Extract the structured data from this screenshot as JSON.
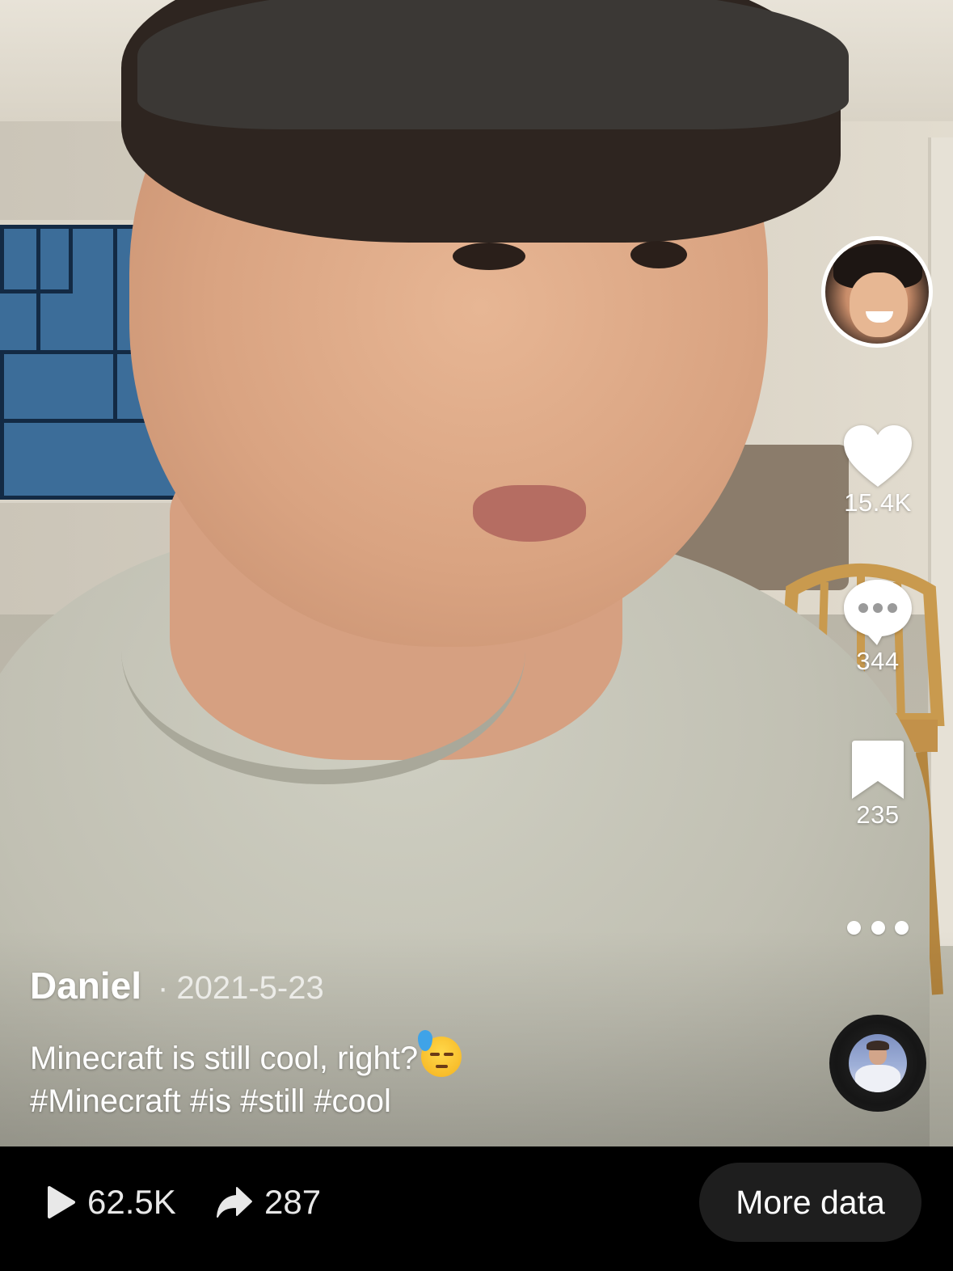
{
  "post": {
    "author": "Daniel",
    "separator": "·",
    "date": "2021-5-23",
    "caption_text": "Minecraft is still cool, right?",
    "caption_emoji": "downcast-face-with-sweat-emoji",
    "hashtags": "#Minecraft #is #still #cool"
  },
  "actions": {
    "likes": "15.4K",
    "comments": "344",
    "saves": "235",
    "more_icon": "ellipsis-icon",
    "avatar_icon": "creator-avatar",
    "sound_icon": "music-disc"
  },
  "stats": {
    "plays": "62.5K",
    "shares": "287"
  },
  "bottom": {
    "more_data_label": "More data"
  },
  "colors": {
    "bar_background": "#000000",
    "button_background": "#1e1e1e",
    "text_primary": "#ffffff",
    "text_secondary": "#bdbdbd"
  }
}
